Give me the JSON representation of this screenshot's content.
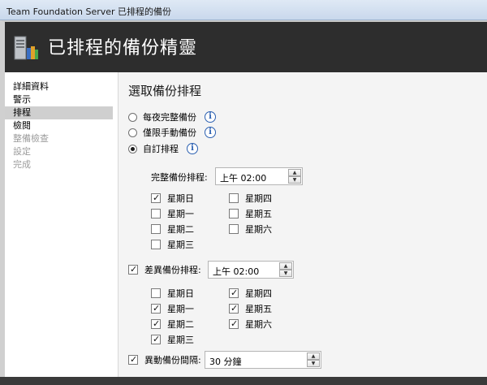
{
  "window": {
    "title": "Team Foundation Server 已排程的備份"
  },
  "header": {
    "title": "已排程的備份精靈",
    "icon": "server-backup-icon"
  },
  "nav": {
    "items": [
      {
        "label": "詳細資料",
        "state": "normal"
      },
      {
        "label": "警示",
        "state": "normal"
      },
      {
        "label": "排程",
        "state": "active"
      },
      {
        "label": "檢閱",
        "state": "normal"
      },
      {
        "label": "整備檢查",
        "state": "disabled"
      },
      {
        "label": "設定",
        "state": "disabled"
      },
      {
        "label": "完成",
        "state": "disabled"
      }
    ]
  },
  "schedule": {
    "heading": "選取備份排程",
    "options": [
      {
        "label": "每夜完整備份",
        "selected": false
      },
      {
        "label": "僅限手動備份",
        "selected": false
      },
      {
        "label": "自訂排程",
        "selected": true
      }
    ],
    "full": {
      "label": "完整備份排程:",
      "time": "上午 02:00",
      "days": [
        {
          "label": "星期日",
          "checked": true
        },
        {
          "label": "星期一",
          "checked": false
        },
        {
          "label": "星期二",
          "checked": false
        },
        {
          "label": "星期三",
          "checked": false
        },
        {
          "label": "星期四",
          "checked": false
        },
        {
          "label": "星期五",
          "checked": false
        },
        {
          "label": "星期六",
          "checked": false
        }
      ]
    },
    "diff": {
      "label": "差異備份排程:",
      "enabled": true,
      "time": "上午 02:00",
      "days": [
        {
          "label": "星期日",
          "checked": false
        },
        {
          "label": "星期一",
          "checked": true
        },
        {
          "label": "星期二",
          "checked": true
        },
        {
          "label": "星期三",
          "checked": true
        },
        {
          "label": "星期四",
          "checked": true
        },
        {
          "label": "星期五",
          "checked": true
        },
        {
          "label": "星期六",
          "checked": true
        }
      ]
    },
    "transaction": {
      "label": "異動備份間隔:",
      "enabled": true,
      "value": "30 分鐘"
    }
  },
  "colors": {
    "header_bg": "#2d2d2d",
    "content_bg": "#f4f4f4",
    "info_blue": "#2a5fb0"
  }
}
